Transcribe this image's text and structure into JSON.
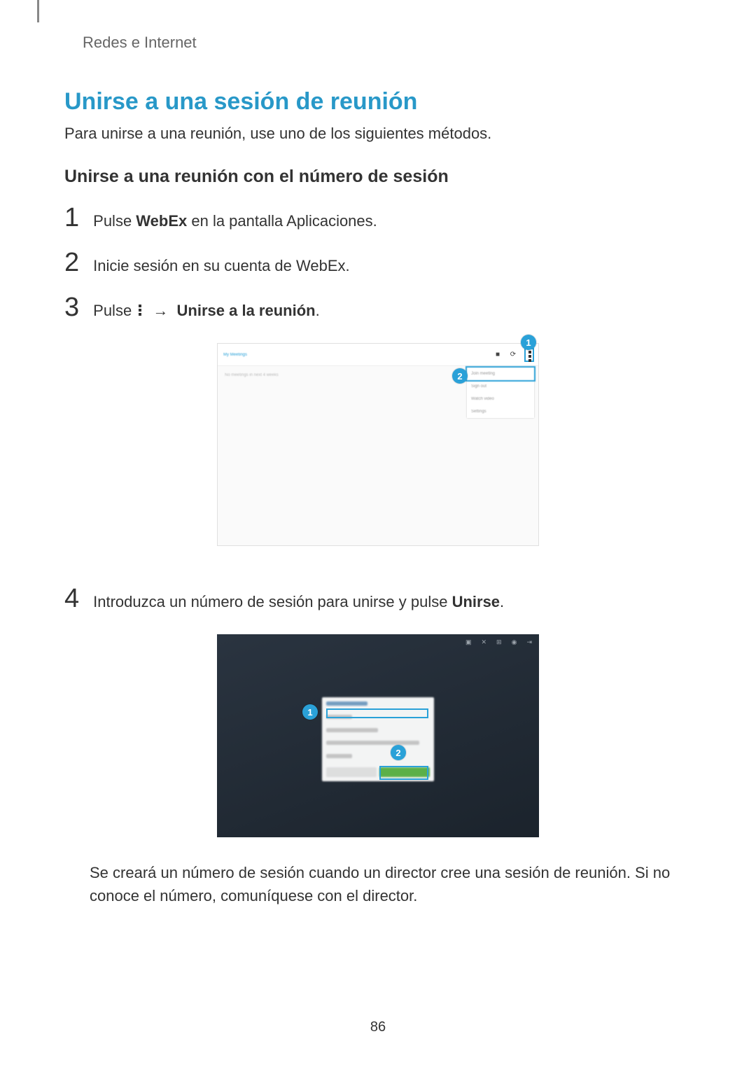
{
  "chapter": "Redes e Internet",
  "title": "Unirse a una sesión de reunión",
  "intro": "Para unirse a una reunión, use uno de los siguientes métodos.",
  "subheading": "Unirse a una reunión con el número de sesión",
  "steps": {
    "s1_num": "1",
    "s1_a": "Pulse ",
    "s1_bold": "WebEx",
    "s1_b": " en la pantalla Aplicaciones.",
    "s2_num": "2",
    "s2": "Inicie sesión en su cuenta de WebEx.",
    "s3_num": "3",
    "s3_a": "Pulse ",
    "s3_arrow": " → ",
    "s3_bold": "Unirse a la reunión",
    "s3_end": ".",
    "s4_num": "4",
    "s4_a": "Introduzca un número de sesión para unirse y pulse ",
    "s4_bold": "Unirse",
    "s4_end": "."
  },
  "shot1": {
    "title": "My Meetings",
    "body_text": "No meetings in next 4 weeks",
    "icon_sq": "■",
    "icon_refresh": "⟳",
    "menu": {
      "m1": "Join meeting",
      "m2": "Sign out",
      "m3": "Watch video",
      "m4": "Settings"
    }
  },
  "callouts": {
    "c1": "1",
    "c2": "2"
  },
  "shot2_icons": {
    "i1": "▣",
    "i2": "✕",
    "i3": "⊞",
    "i4": "◉",
    "i5": "⇥"
  },
  "note": "Se creará un número de sesión cuando un director cree una sesión de reunión. Si no conoce el número, comuníquese con el director.",
  "pagenum": "86"
}
